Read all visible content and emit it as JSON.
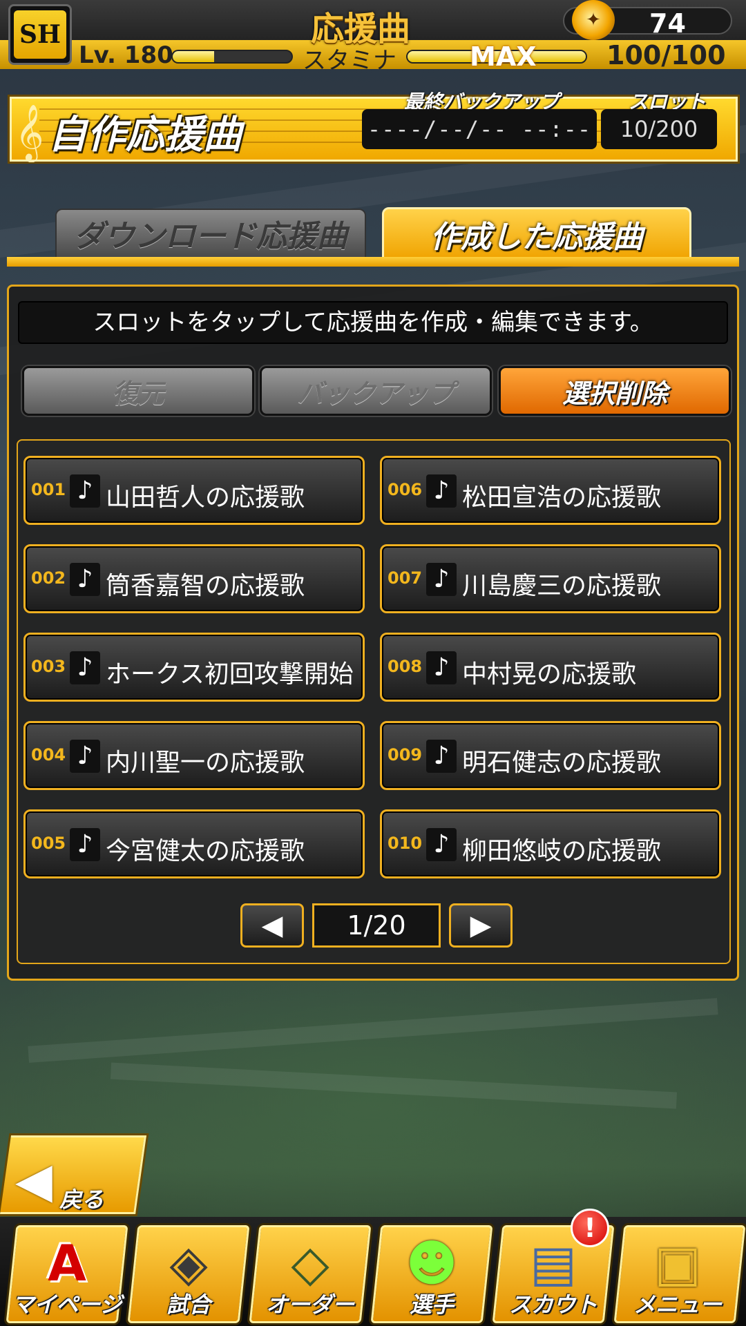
{
  "header": {
    "logo": "SH",
    "title": "応援曲",
    "coins": "74",
    "level_label": "Lv. 180",
    "level_progress": 0.35,
    "stamina_label": "スタミナ",
    "stamina_max_label": "MAX",
    "stamina_value": "100/100",
    "stamina_progress": 1.0
  },
  "plate": {
    "title": "自作応援曲",
    "backup_label": "最終バックアップ",
    "backup_value": "----/--/-- --:--",
    "slot_label": "スロット",
    "slot_value": "10/200"
  },
  "tabs": [
    {
      "label": "ダウンロード応援曲",
      "active": false
    },
    {
      "label": "作成した応援曲",
      "active": true
    }
  ],
  "notice": "スロットをタップして応援曲を作成・編集できます。",
  "actions": {
    "restore": "復元",
    "backup": "バックアップ",
    "delete": "選択削除"
  },
  "slots": [
    {
      "num": "001",
      "note": "♪",
      "name": "山田哲人の応援歌"
    },
    {
      "num": "002",
      "note": "♪",
      "name": "筒香嘉智の応援歌"
    },
    {
      "num": "003",
      "note": "♪",
      "name": "ホークス初回攻撃開始"
    },
    {
      "num": "004",
      "note": "♪",
      "name": "内川聖一の応援歌"
    },
    {
      "num": "005",
      "note": "♪",
      "name": "今宮健太の応援歌"
    },
    {
      "num": "006",
      "note": "♪",
      "name": "松田宣浩の応援歌"
    },
    {
      "num": "007",
      "note": "♪",
      "name": "川島慶三の応援歌"
    },
    {
      "num": "008",
      "note": "♪",
      "name": "中村晃の応援歌"
    },
    {
      "num": "009",
      "note": "♪",
      "name": "明石健志の応援歌"
    },
    {
      "num": "010",
      "note": "♪",
      "name": "柳田悠岐の応援歌"
    }
  ],
  "pager": {
    "prev": "◀",
    "value": "1/20",
    "next": "▶"
  },
  "back": {
    "label": "戻る",
    "arrow": "◀"
  },
  "nav": [
    {
      "label": "マイページ",
      "icon": "A",
      "icon_name": "mypage-a-icon"
    },
    {
      "label": "試合",
      "icon": "◈",
      "icon_name": "stadium-icon"
    },
    {
      "label": "オーダー",
      "icon": "◇",
      "icon_name": "diamond-field-icon"
    },
    {
      "label": "選手",
      "icon": "☻",
      "icon_name": "player-icon"
    },
    {
      "label": "スカウト",
      "icon": "▤",
      "icon_name": "scout-card-icon"
    },
    {
      "label": "メニュー",
      "icon": "▣",
      "icon_name": "menu-box-icon"
    }
  ],
  "scout_badge": "!",
  "colors": {
    "accent": "#f3b71d",
    "delete_button": "#e06800",
    "badge": "#d40000"
  }
}
